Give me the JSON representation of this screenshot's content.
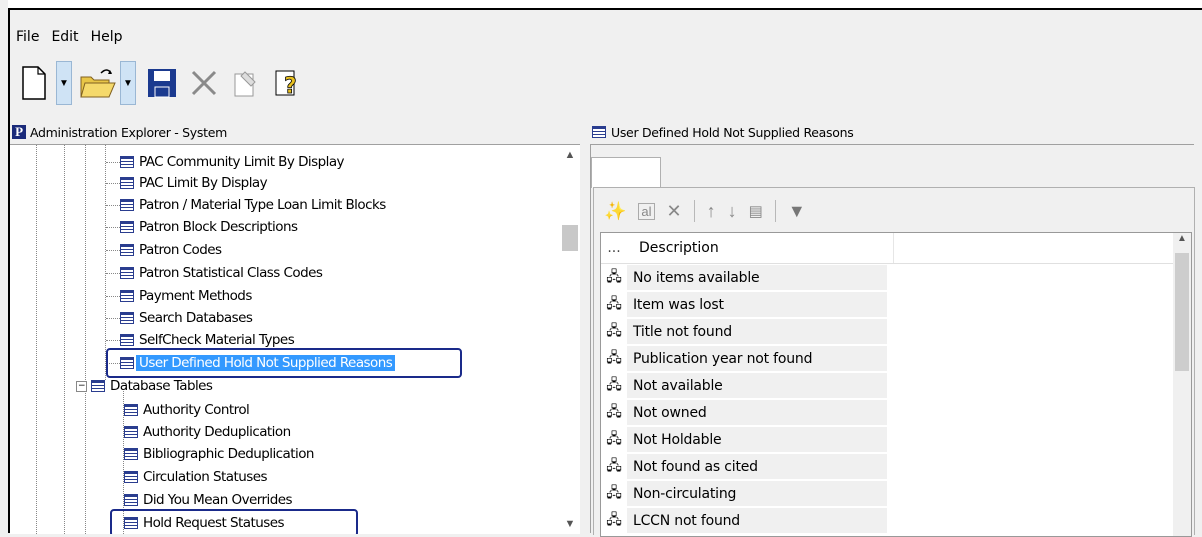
{
  "menu": [
    "File",
    "Edit",
    "Help"
  ],
  "toolbar": {
    "buttons": [
      "new-document-icon",
      "open-folder-icon",
      "save-icon",
      "delete-icon",
      "properties-icon",
      "help-icon"
    ]
  },
  "left_panel": {
    "title": "Administration Explorer - System",
    "items": [
      "PAC Community Limit By Display",
      "PAC Limit By Display",
      "Patron / Material Type Loan Limit Blocks",
      "Patron Block Descriptions",
      "Patron Codes",
      "Patron Statistical Class Codes",
      "Payment Methods",
      "Search Databases",
      "SelfCheck Material Types",
      "User Defined Hold Not Supplied Reasons"
    ],
    "group_label": "Database Tables",
    "group_items": [
      "Authority Control",
      "Authority Deduplication",
      "Bibliographic Deduplication",
      "Circulation Statuses",
      "Did You Mean Overrides",
      "Hold Request Statuses"
    ],
    "selected": "User Defined Hold Not Supplied Reasons",
    "highlight_color": "#3399ff"
  },
  "right_panel": {
    "title": "User Defined Hold Not Supplied Reasons",
    "grid": {
      "columns": [
        "...",
        "Description"
      ],
      "rows": [
        "No items available",
        "Item was lost",
        "Title not found",
        "Publication year not found",
        "Not available",
        "Not owned",
        "Not Holdable",
        "Not found as cited",
        "Non-circulating",
        "LCCN not found"
      ]
    }
  }
}
